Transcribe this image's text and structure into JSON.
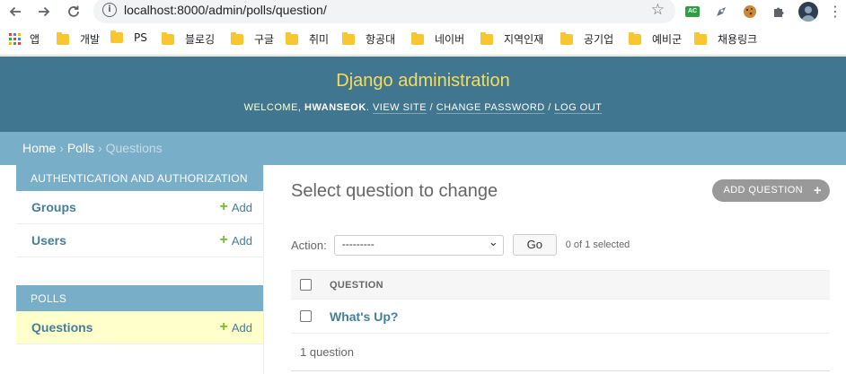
{
  "browser": {
    "url": "localhost:8000/admin/polls/question/",
    "ext_badge": "AC"
  },
  "bookmarks": [
    {
      "label": "앱",
      "type": "apps"
    },
    {
      "label": "개발",
      "type": "folder"
    },
    {
      "label": "PS",
      "type": "folder"
    },
    {
      "label": "블로깅",
      "type": "folder"
    },
    {
      "label": "구글",
      "type": "folder"
    },
    {
      "label": "취미",
      "type": "folder"
    },
    {
      "label": "항공대",
      "type": "folder"
    },
    {
      "label": "네이버",
      "type": "folder"
    },
    {
      "label": "지역인재",
      "type": "folder"
    },
    {
      "label": "공기업",
      "type": "folder"
    },
    {
      "label": "예비군",
      "type": "folder"
    },
    {
      "label": "채용링크",
      "type": "folder"
    }
  ],
  "header": {
    "brand": "Django administration",
    "welcome": "WELCOME, ",
    "username": "HWANSEOK",
    "view_site": "VIEW SITE",
    "change_password": "CHANGE PASSWORD",
    "log_out": "LOG OUT",
    "sep": " / "
  },
  "breadcrumbs": {
    "home": "Home",
    "polls": "Polls",
    "current": "Questions",
    "separator": " › "
  },
  "sidebar": {
    "sections": [
      {
        "title": "AUTHENTICATION AND AUTHORIZATION",
        "items": [
          {
            "name": "Groups",
            "add": "Add"
          },
          {
            "name": "Users",
            "add": "Add"
          }
        ]
      },
      {
        "title": "POLLS",
        "items": [
          {
            "name": "Questions",
            "add": "Add"
          }
        ]
      }
    ]
  },
  "content": {
    "title": "Select question to change",
    "add_button": "ADD QUESTION",
    "action_label": "Action:",
    "action_selected": "---------",
    "go_label": "Go",
    "selected_count": "0 of 1 selected",
    "column_header": "QUESTION",
    "rows": [
      {
        "question": "What's Up?"
      }
    ],
    "paginator": "1 question"
  },
  "colors": {
    "header_bg": "#417690",
    "brand": "#f5dd5d",
    "breadcrumb_bg": "#79aec8",
    "link": "#447e9b",
    "add_green": "#70bf2b",
    "active_row": "#ffffcc"
  }
}
